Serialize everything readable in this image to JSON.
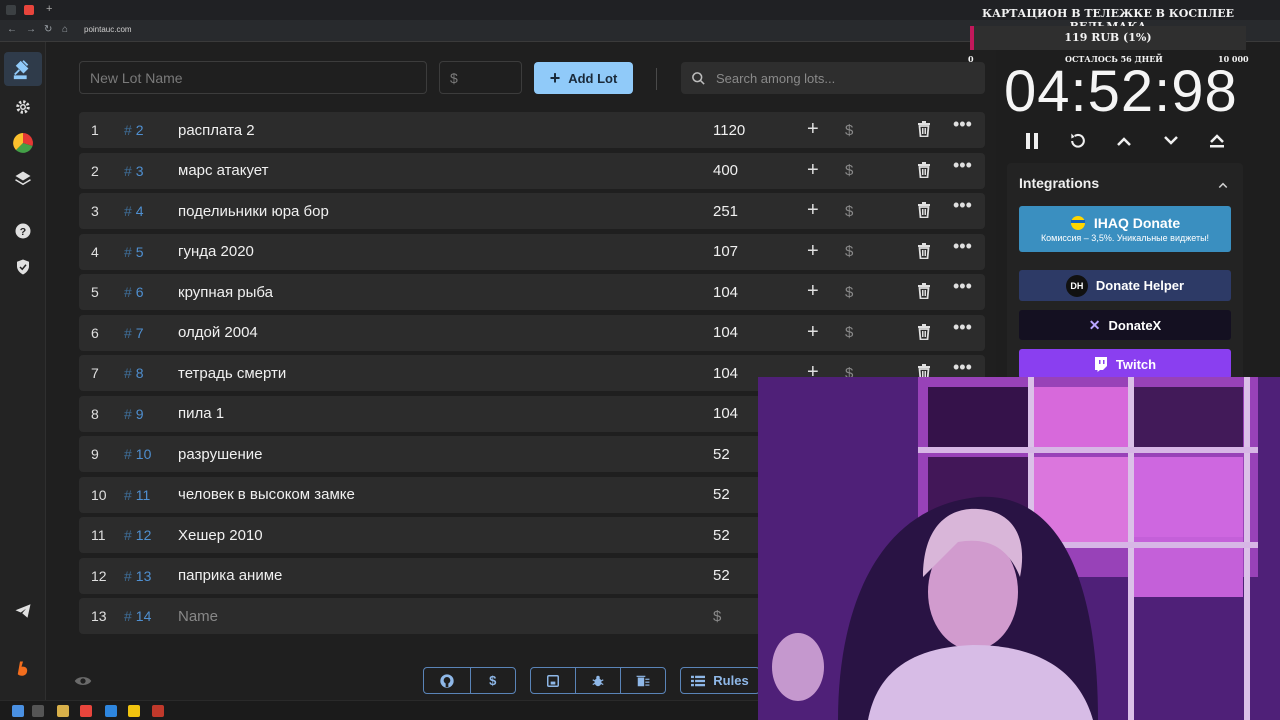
{
  "browser": {
    "url": "pointauc.com"
  },
  "overlay": {
    "title": "КАРТАЦИОН В ТЕЛЕЖКЕ В КОСПЛЕЕ ВЕДЬМАКА",
    "progress_text": "119 RUB (1%)",
    "progress_fraction": 0.01,
    "scale_min": "0",
    "scale_caption": "ОСТАЛОСЬ 56 ДНЕЙ",
    "scale_max": "10 000"
  },
  "toolbar": {
    "lot_name_placeholder": "New Lot Name",
    "amount_placeholder": "$",
    "add_lot_label": "Add Lot",
    "search_placeholder": "Search among lots..."
  },
  "lots": [
    {
      "index": "1",
      "fast_id": "2",
      "name": "расплата 2",
      "amount": "1120"
    },
    {
      "index": "2",
      "fast_id": "3",
      "name": "марс атакует",
      "amount": "400"
    },
    {
      "index": "3",
      "fast_id": "4",
      "name": "поделиьники юра бор",
      "amount": "251"
    },
    {
      "index": "4",
      "fast_id": "5",
      "name": "гунда 2020",
      "amount": "107"
    },
    {
      "index": "5",
      "fast_id": "6",
      "name": "крупная рыба",
      "amount": "104"
    },
    {
      "index": "6",
      "fast_id": "7",
      "name": "олдой 2004",
      "amount": "104"
    },
    {
      "index": "7",
      "fast_id": "8",
      "name": "тетрадь смерти",
      "amount": "104"
    },
    {
      "index": "8",
      "fast_id": "9",
      "name": "пила 1",
      "amount": "104"
    },
    {
      "index": "9",
      "fast_id": "10",
      "name": "разрушение",
      "amount": "52"
    },
    {
      "index": "10",
      "fast_id": "11",
      "name": "человек в высоком замке",
      "amount": "52"
    },
    {
      "index": "11",
      "fast_id": "12",
      "name": "Хешер 2010",
      "amount": "52"
    },
    {
      "index": "12",
      "fast_id": "13",
      "name": "паприка аниме",
      "amount": "52"
    }
  ],
  "new_row": {
    "index": "13",
    "fast_id": "14",
    "name_placeholder": "Name",
    "amount_placeholder": "$"
  },
  "row_symbols": {
    "hash": "#",
    "plus": "+",
    "dollar": "$",
    "more": "•••"
  },
  "footer": {
    "rules_label": "Rules",
    "dollar_label": "$"
  },
  "timer": {
    "value": "04:52:98"
  },
  "integrations": {
    "title": "Integrations",
    "ihaq_label": "IHAQ Donate",
    "ihaq_sub": "Комиссия – 3,5%. Уникальные виджеты!",
    "donate_helper_label": "Donate Helper",
    "donatex_label": "DonateX",
    "twitch_label": "Twitch"
  },
  "colors": {
    "accent": "#90caf9",
    "ihaq": "#3a8fc0",
    "donate_helper": "#2d3a66",
    "donatex": "#141021",
    "twitch": "#8a3ff0",
    "overlay_fill": "#c2185b"
  },
  "icons": {
    "sidebar": [
      "gavel-icon",
      "gear-icon",
      "pie-chart-icon",
      "layers-icon",
      "help-icon",
      "shield-icon",
      "telegram-icon",
      "boosty-icon"
    ]
  }
}
